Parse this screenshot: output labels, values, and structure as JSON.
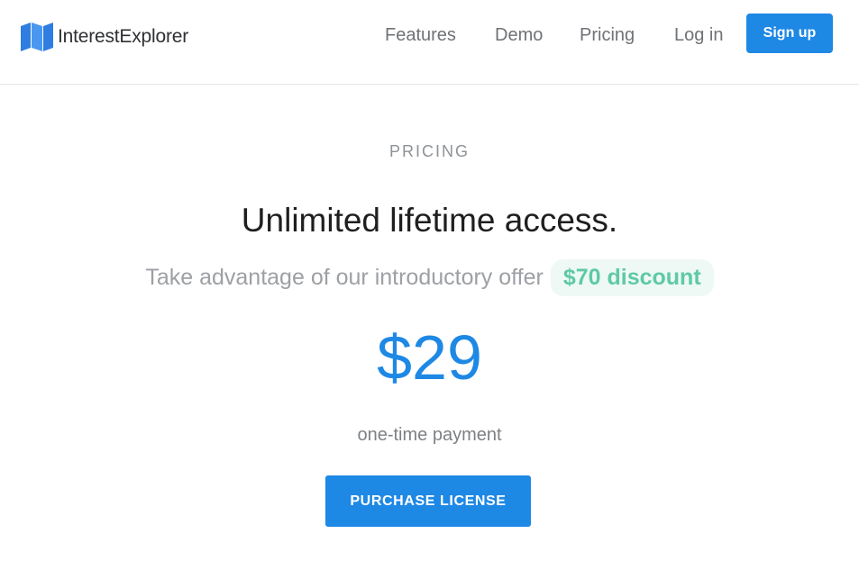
{
  "header": {
    "brand_name": "InterestExplorer",
    "brand_icon": "map-icon",
    "nav": {
      "features": "Features",
      "demo": "Demo",
      "pricing": "Pricing",
      "login": "Log in"
    },
    "signup_label": "Sign up"
  },
  "pricing": {
    "eyebrow": "PRICING",
    "headline": "Unlimited lifetime access.",
    "offer_text": "Take advantage of our introductory offer",
    "discount": "$70 discount",
    "price": "$29",
    "price_note": "one-time payment",
    "purchase_label": "PURCHASE LICENSE"
  },
  "colors": {
    "accent": "#1e88e5",
    "discount_text": "#5ecaa5",
    "discount_bg": "#eef8f5"
  }
}
